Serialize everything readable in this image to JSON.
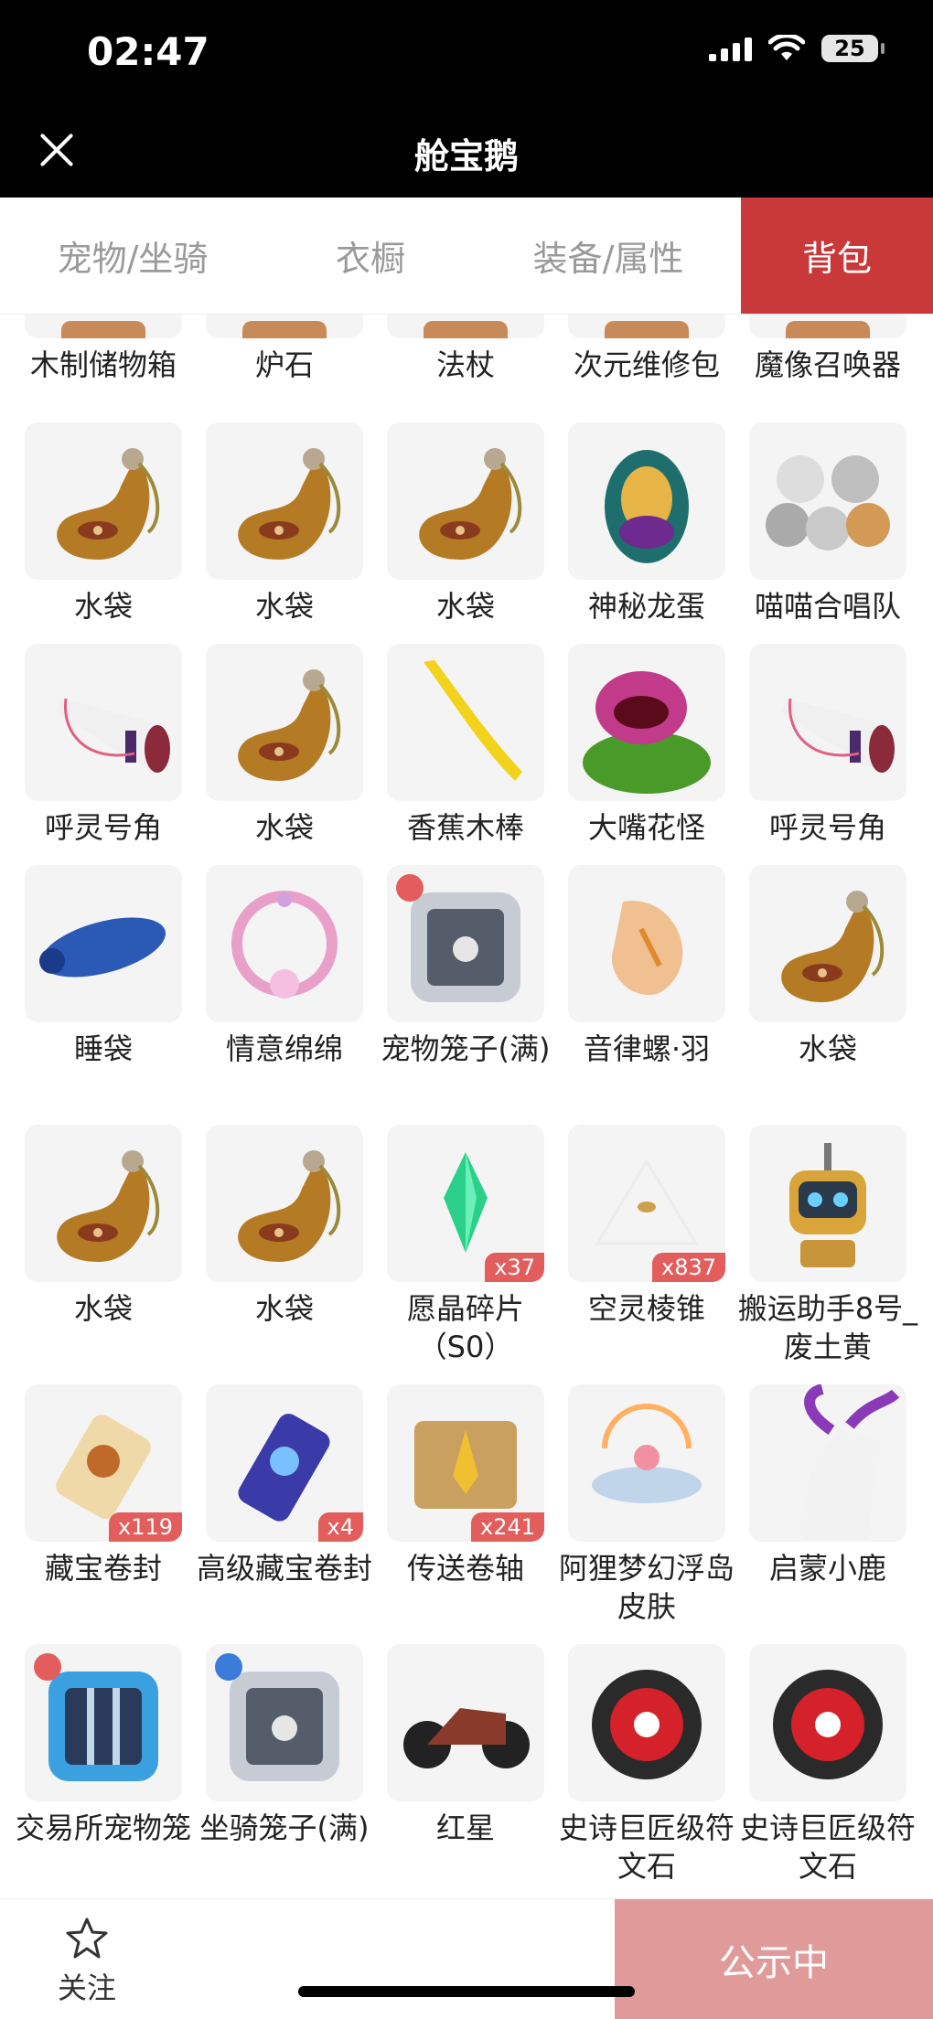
{
  "status": {
    "time": "02:47",
    "battery": "25"
  },
  "nav": {
    "title": "舱宝鹅"
  },
  "tabs": [
    {
      "label": "宠物/坐骑",
      "active": false
    },
    {
      "label": "衣橱",
      "active": false
    },
    {
      "label": "装备/属性",
      "active": false
    },
    {
      "label": "背包",
      "active": true
    }
  ],
  "items": [
    {
      "name": "木制储物箱",
      "icon": "wooden-box-icon",
      "cut": true
    },
    {
      "name": "炉石",
      "icon": "hearthstone-icon",
      "cut": true
    },
    {
      "name": "法杖",
      "icon": "staff-icon",
      "cut": true
    },
    {
      "name": "次元维修包",
      "icon": "repair-kit-icon",
      "cut": true
    },
    {
      "name": "魔像召唤器",
      "icon": "golem-summoner-icon",
      "cut": true
    },
    {
      "name": "水袋",
      "icon": "water-bag-icon"
    },
    {
      "name": "水袋",
      "icon": "water-bag-icon"
    },
    {
      "name": "水袋",
      "icon": "water-bag-icon"
    },
    {
      "name": "神秘龙蛋",
      "icon": "dragon-egg-icon"
    },
    {
      "name": "喵喵合唱队",
      "icon": "cat-choir-icon"
    },
    {
      "name": "呼灵号角",
      "icon": "horn-icon"
    },
    {
      "name": "水袋",
      "icon": "water-bag-icon"
    },
    {
      "name": "香蕉木棒",
      "icon": "banana-club-icon"
    },
    {
      "name": "大嘴花怪",
      "icon": "plant-monster-icon"
    },
    {
      "name": "呼灵号角",
      "icon": "horn-icon"
    },
    {
      "name": "睡袋",
      "icon": "sleeping-bag-icon"
    },
    {
      "name": "情意绵绵",
      "icon": "wreath-icon"
    },
    {
      "name": "宠物笼子(满)",
      "icon": "pet-cage-icon",
      "badge": "red"
    },
    {
      "name": "音律螺·羽",
      "icon": "shell-icon"
    },
    {
      "name": "水袋",
      "icon": "water-bag-icon"
    },
    {
      "name": "水袋",
      "icon": "water-bag-icon"
    },
    {
      "name": "水袋",
      "icon": "water-bag-icon"
    },
    {
      "name": "愿晶碎片（S0）",
      "icon": "crystal-shard-icon",
      "qty": "x37"
    },
    {
      "name": "空灵棱锥",
      "icon": "pyramid-icon",
      "qty": "x837"
    },
    {
      "name": "搬运助手8号_废土黄",
      "icon": "robot-icon"
    },
    {
      "name": "藏宝卷封",
      "icon": "treasure-scroll-icon",
      "qty": "x119"
    },
    {
      "name": "高级藏宝卷封",
      "icon": "advanced-scroll-icon",
      "qty": "x4"
    },
    {
      "name": "传送卷轴",
      "icon": "teleport-scroll-icon",
      "qty": "x241"
    },
    {
      "name": "阿狸梦幻浮岛皮肤",
      "icon": "floating-island-icon"
    },
    {
      "name": "启蒙小鹿",
      "icon": "deer-icon"
    },
    {
      "name": "交易所宠物笼",
      "icon": "exchange-cage-icon",
      "badge": "red"
    },
    {
      "name": "坐骑笼子(满)",
      "icon": "mount-cage-icon",
      "badge": "blue"
    },
    {
      "name": "红星",
      "icon": "motorcycle-icon"
    },
    {
      "name": "史诗巨匠级符文石",
      "icon": "rune-stone-icon"
    },
    {
      "name": "史诗巨匠级符文石",
      "icon": "rune-stone-icon"
    }
  ],
  "bottom": {
    "follow_label": "关注",
    "public_label": "公示中"
  }
}
